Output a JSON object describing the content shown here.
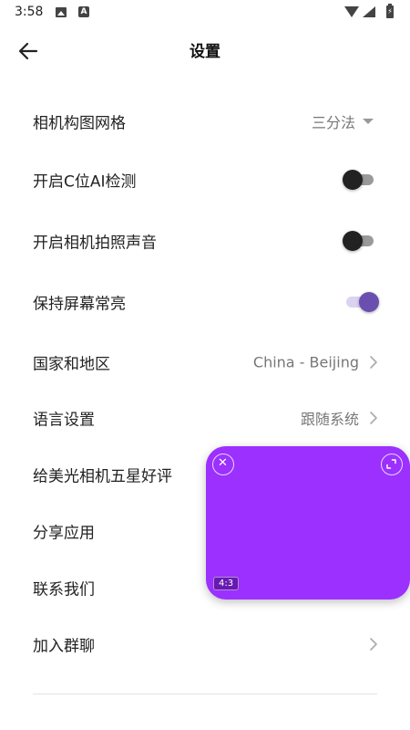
{
  "status_bar": {
    "time": "3:58",
    "a_icon_letter": "A"
  },
  "app_bar": {
    "title": "设置"
  },
  "settings": {
    "grid_label": "相机构图网格",
    "grid_value": "三分法",
    "c_ai_label": "开启C位AI检测",
    "c_ai_on": false,
    "shutter_sound_label": "开启相机拍照声音",
    "shutter_sound_on": false,
    "screen_on_label": "保持屏幕常亮",
    "screen_on_on": true,
    "region_label": "国家和地区",
    "region_value": "China - Beijing",
    "language_label": "语言设置",
    "language_value": "跟随系统",
    "rate_label": "给美光相机五星好评",
    "share_label": "分享应用",
    "contact_label": "联系我们",
    "group_label": "加入群聊"
  },
  "floating_preview": {
    "ratio": "4:3",
    "background": "#9b30ff"
  },
  "colors": {
    "accent": "#6a4fb0",
    "text_primary": "#222222",
    "text_secondary": "#777777"
  }
}
